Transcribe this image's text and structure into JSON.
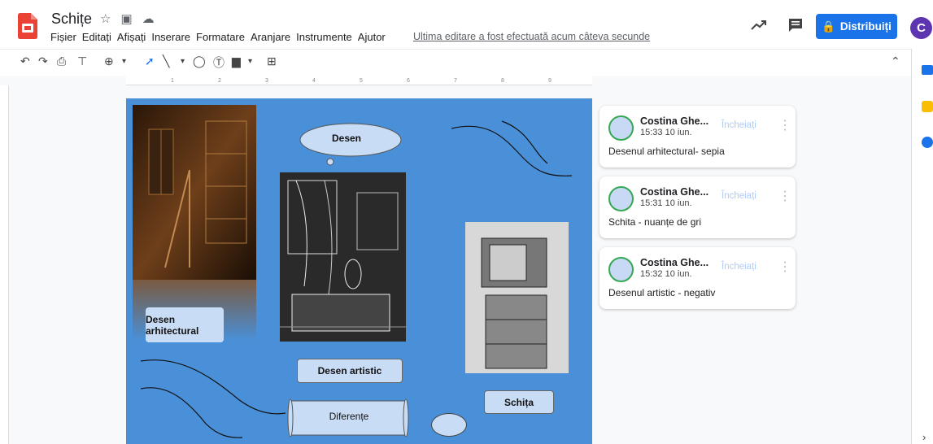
{
  "header": {
    "title": "Schițe",
    "menu": [
      "Fișier",
      "Editați",
      "Afișați",
      "Inserare",
      "Formatare",
      "Aranjare",
      "Instrumente",
      "Ajutor"
    ],
    "last_edit": "Ultima editare a fost efectuată acum câteva secunde",
    "share_label": "Distribuiți",
    "avatar_letter": "C",
    "brand_color": "#1a73e8"
  },
  "slide": {
    "bg_color": "#4a90d9",
    "cloud_label": "Desen",
    "arch_label": "Desen arhitectural",
    "artistic_label": "Desen artistic",
    "sketch_label": "Schița",
    "scroll_label": "Diferențe"
  },
  "comments": [
    {
      "author": "Costina Ghe...",
      "time": "15:33 10 iun.",
      "action": "Încheiați",
      "text": "Desenul arhitectural- sepia"
    },
    {
      "author": "Costina Ghe...",
      "time": "15:31 10 iun.",
      "action": "Încheiați",
      "text": "Schita - nuanțe de gri"
    },
    {
      "author": "Costina Ghe...",
      "time": "15:32 10 iun.",
      "action": "Încheiați",
      "text": "Desenul artistic - negativ"
    }
  ]
}
